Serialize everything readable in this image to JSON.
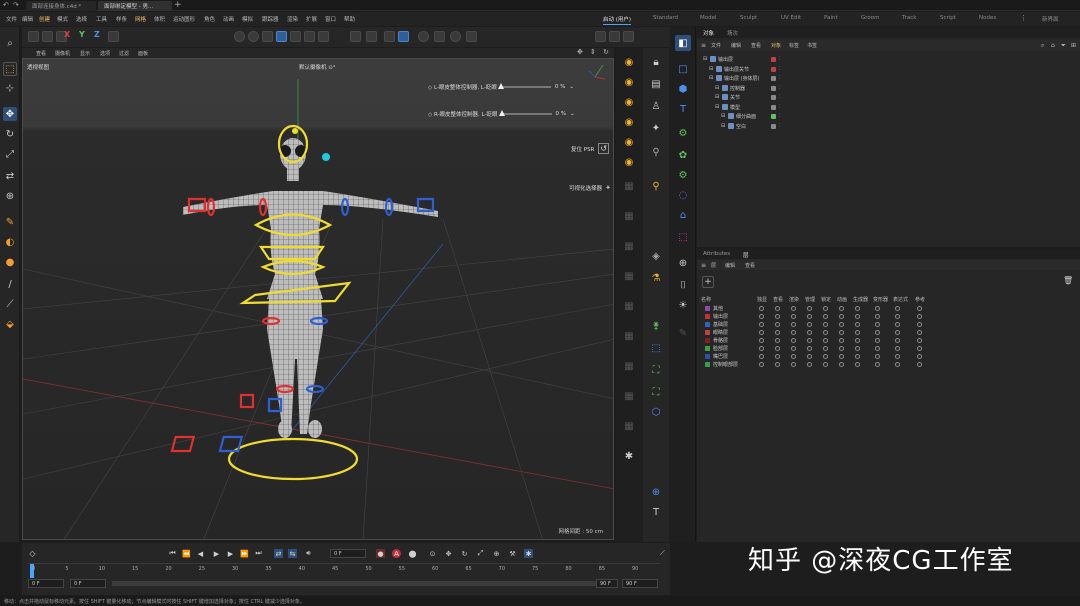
{
  "tabs": [
    {
      "label": "面部连接身体.c4d *",
      "active": false
    },
    {
      "label": "面部绑定模型 - 男...",
      "active": true
    }
  ],
  "menu": [
    "文件",
    "编辑",
    "创建",
    "模式",
    "选择",
    "工具",
    "样条",
    "网格",
    "体积",
    "运动图形",
    "角色",
    "动画",
    "模拟",
    "跟踪器",
    "渲染",
    "扩展",
    "窗口",
    "帮助"
  ],
  "menu_highlight": [
    "创建",
    "网格"
  ],
  "layouts": [
    {
      "label": "启动 (用户)",
      "active": true
    },
    {
      "label": "Standard",
      "active": false
    },
    {
      "label": "Model",
      "active": false
    },
    {
      "label": "Sculpt",
      "active": false
    },
    {
      "label": "UV Edit",
      "active": false
    },
    {
      "label": "Paint",
      "active": false
    },
    {
      "label": "Groom",
      "active": false
    },
    {
      "label": "Track",
      "active": false
    },
    {
      "label": "Script",
      "active": false
    },
    {
      "label": "Nodes",
      "active": false
    }
  ],
  "new_layout": "新界面",
  "viewport": {
    "menu": [
      "查看",
      "摄像机",
      "显示",
      "选项",
      "过滤",
      "面板"
    ],
    "title": "透视视图",
    "camera": "默认摄像机 ⊙°",
    "slider1": {
      "label": "◇ L-眼皮整体控制器. L-眨眼",
      "value": "0 %",
      "fraction": 0.0
    },
    "slider2": {
      "label": "◇ R-眼皮整体控制器. L-眨眼",
      "value": "0 %",
      "fraction": 0.0
    },
    "reset_psr": "复位 PSR",
    "visible_selector": "可视化选择器",
    "grid_distance": "网格间距 : 50 cm"
  },
  "object_manager": {
    "tabs": [
      {
        "label": "对象",
        "active": true
      },
      {
        "label": "场次",
        "active": false
      }
    ],
    "menu": [
      "文件",
      "编辑",
      "查看",
      "对象",
      "标签",
      "书签"
    ],
    "tree": [
      {
        "name": "输出层",
        "indent": 0,
        "tag": "#c0404a"
      },
      {
        "name": "输出层关节",
        "indent": 1,
        "tag": "#c0404a"
      },
      {
        "name": "输出层 (身体层)",
        "indent": 1,
        "tag": "#8a8a8a"
      },
      {
        "name": "控制器",
        "indent": 2,
        "tag": "#8a8a8a"
      },
      {
        "name": "关节",
        "indent": 2,
        "tag": "#8a8a8a"
      },
      {
        "name": "模型",
        "indent": 2,
        "tag": "#8a8a8a"
      },
      {
        "name": "细分曲面",
        "indent": 3,
        "tag": "#5ec25e"
      },
      {
        "name": "空白",
        "indent": 3,
        "tag": "#8a8a8a"
      }
    ]
  },
  "attributes": {
    "tabs": [
      {
        "label": "Attributes",
        "active": false
      },
      {
        "label": "层",
        "active": true
      }
    ],
    "menu": [
      "层",
      "编辑",
      "查看"
    ],
    "columns": [
      "名称",
      "独显",
      "查看",
      "渲染",
      "管理",
      "锁定",
      "动画",
      "生成器",
      "变形器",
      "表达式",
      "参考"
    ],
    "layers": [
      {
        "name": "其他",
        "color": "#8a4ab0"
      },
      {
        "name": "输出层",
        "color": "#c03030"
      },
      {
        "name": "基础层",
        "color": "#3060c0"
      },
      {
        "name": "眼睛层",
        "color": "#c04040"
      },
      {
        "name": "骨骼层",
        "color": "#802020"
      },
      {
        "name": "脸部层",
        "color": "#40a040"
      },
      {
        "name": "嘴巴层",
        "color": "#3050b0"
      },
      {
        "name": "控制眼部层",
        "color": "#30a050"
      }
    ]
  },
  "timeline": {
    "current_frame": "0 F",
    "start": "0 F",
    "start2": "0 F",
    "end": "90 F",
    "end2": "90 F",
    "ruler": [
      "0",
      "5",
      "10",
      "15",
      "20",
      "25",
      "30",
      "35",
      "40",
      "45",
      "50",
      "55",
      "60",
      "65",
      "70",
      "75",
      "80",
      "85",
      "90"
    ]
  },
  "status_text": "移动：点击并拖动鼠标移动元素。按住 SHIFT 键量化移动；节点编辑模式时按住 SHIFT 键增加选择对象；按住 CTRL 键减少选择对象。",
  "watermark": "知乎 @深夜CG工作室",
  "colors": {
    "accent": "#4aa3ff",
    "active_icon": "#2d4f78",
    "highlight_menu": "#f0c060"
  }
}
